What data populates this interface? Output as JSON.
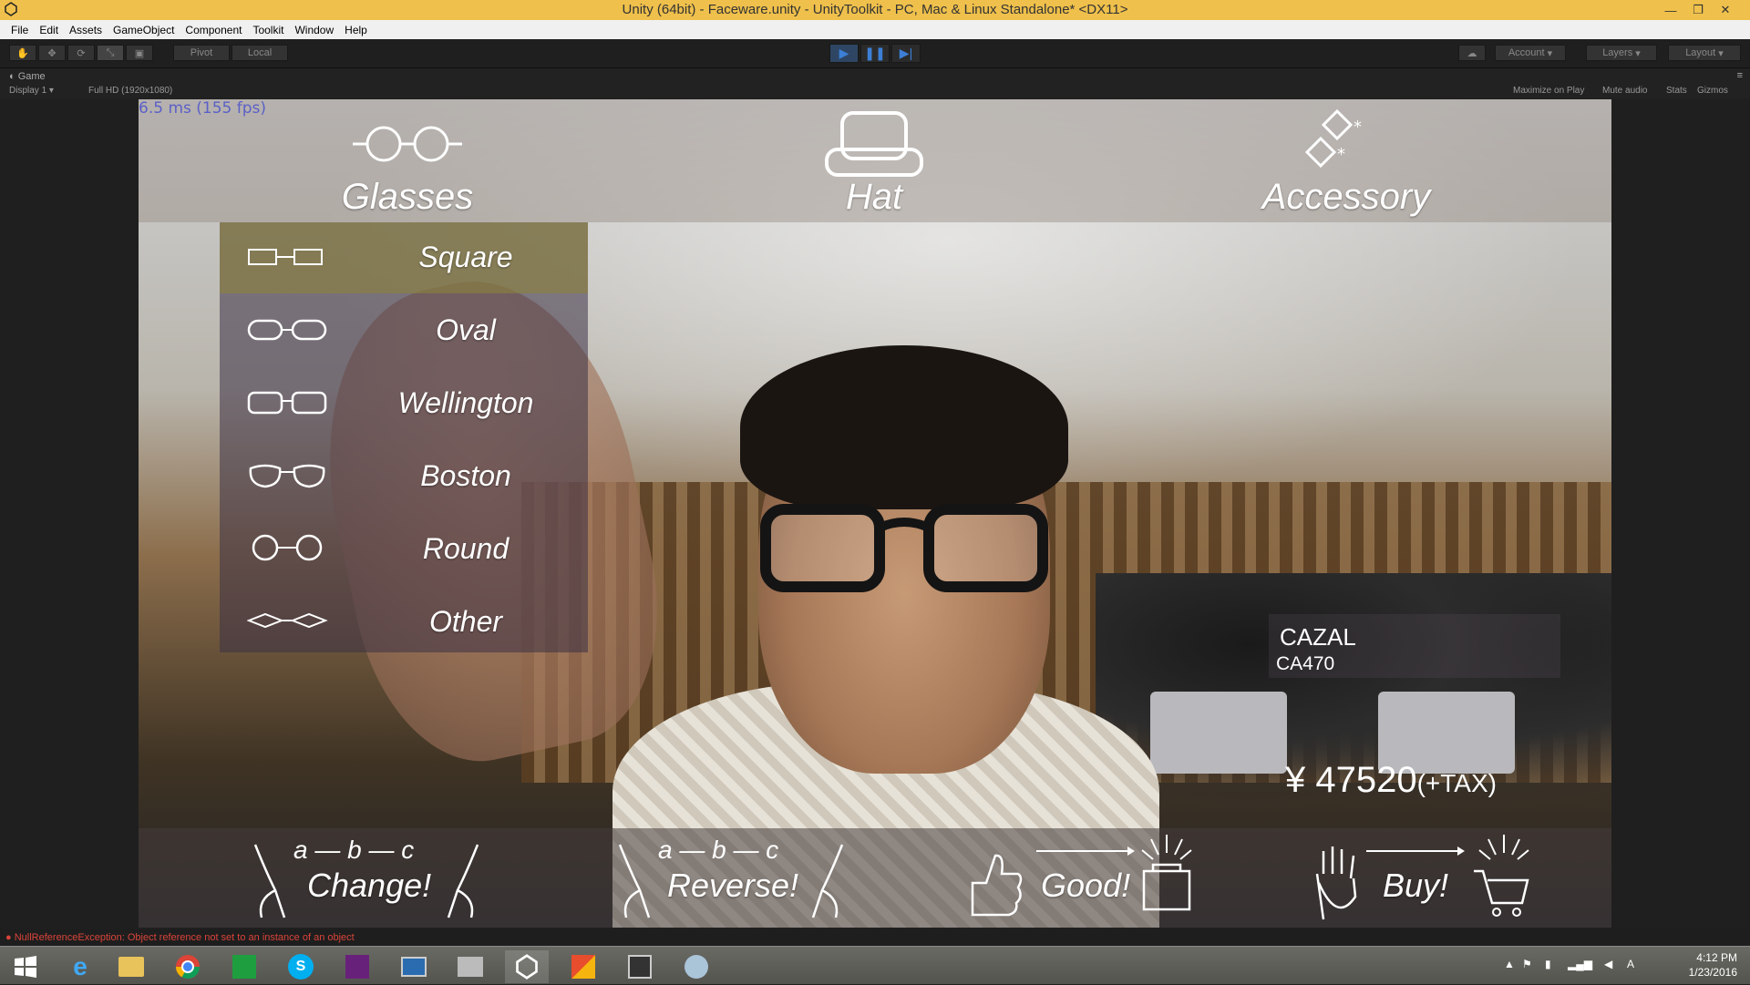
{
  "window": {
    "title": "Unity (64bit) - Faceware.unity - UnityToolkit - PC, Mac & Linux Standalone* <DX11>"
  },
  "menubar": [
    "File",
    "Edit",
    "Assets",
    "GameObject",
    "Component",
    "Toolkit",
    "Window",
    "Help"
  ],
  "toolbar": {
    "pivot": "Pivot",
    "local": "Local",
    "account": "Account",
    "layers": "Layers",
    "layout": "Layout"
  },
  "game_tab": {
    "label": "Game",
    "display": "Display 1",
    "resolution": "Full HD (1920x1080)",
    "maximize_on_play": "Maximize on Play",
    "mute_audio": "Mute audio",
    "stats": "Stats",
    "gizmos": "Gizmos"
  },
  "game": {
    "fps": "6.5 ms (155 fps)",
    "categories": [
      "Glasses",
      "Hat",
      "Accessory"
    ],
    "glasses_menu": [
      {
        "label": "Square",
        "icon": "square-glasses-icon",
        "selected": true
      },
      {
        "label": "Oval",
        "icon": "oval-glasses-icon",
        "selected": false
      },
      {
        "label": "Wellington",
        "icon": "wellington-glasses-icon",
        "selected": false
      },
      {
        "label": "Boston",
        "icon": "boston-glasses-icon",
        "selected": false
      },
      {
        "label": "Round",
        "icon": "round-glasses-icon",
        "selected": false
      },
      {
        "label": "Other",
        "icon": "other-glasses-icon",
        "selected": false
      }
    ],
    "product": {
      "brand": "CAZAL",
      "model": "CA470",
      "price": "¥ 47520",
      "tax": "(+TAX)"
    },
    "gestures": [
      {
        "seq": "a — b — c",
        "label": "Change!"
      },
      {
        "seq": "a — b — c",
        "label": "Reverse!"
      },
      {
        "label": "Good!"
      },
      {
        "label": "Buy!"
      }
    ]
  },
  "console": {
    "error": "NullReferenceException: Object reference not set to an instance of an object"
  },
  "taskbar": {
    "time": "4:12 PM",
    "date": "1/23/2016"
  },
  "colors": {
    "titlebar": "#efc04b",
    "fps": "#2a3cff",
    "error": "#d9443a"
  }
}
